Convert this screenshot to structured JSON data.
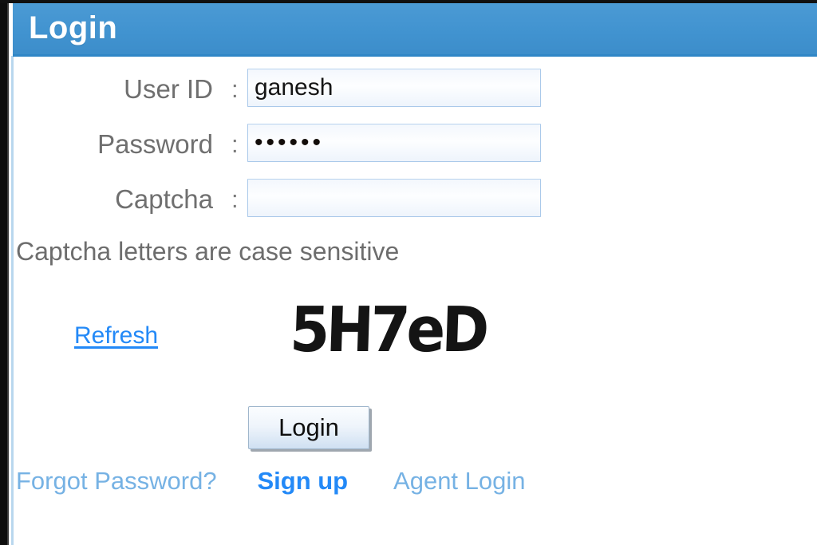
{
  "window": {
    "title": "Login"
  },
  "form": {
    "fields": [
      {
        "label": "User ID",
        "colon": ":",
        "value": "ganesh",
        "placeholder": "",
        "type": "text"
      },
      {
        "label": "Password",
        "colon": ":",
        "value": "••••••",
        "placeholder": "",
        "type": "password"
      },
      {
        "label": "Captcha",
        "colon": ":",
        "value": "",
        "placeholder": "",
        "type": "text"
      }
    ],
    "note": "Captcha letters are case sensitive",
    "refresh_label": "Refresh",
    "captcha_text": "5H7eD",
    "submit_label": "Login"
  },
  "footer": {
    "links": [
      {
        "label": "Forgot Password?",
        "style": "muted"
      },
      {
        "label": "Sign up",
        "style": "strong"
      },
      {
        "label": "Agent Login",
        "style": "muted"
      }
    ]
  },
  "colors": {
    "header_blue": "#4193d0",
    "link_blue": "#2389f7",
    "link_blue_muted": "#76b2e4",
    "label_gray": "#6f6f6f",
    "input_border": "#aac9ea",
    "page_background": "#ffffff"
  }
}
